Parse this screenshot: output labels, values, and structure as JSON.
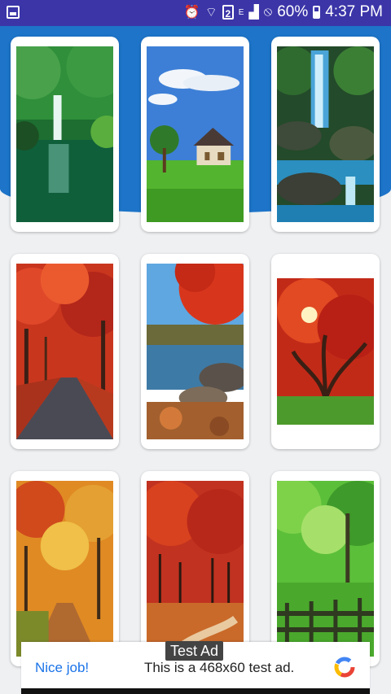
{
  "status_bar": {
    "battery": "60%",
    "time": "4:37 PM",
    "sim_badge": "2",
    "network_letter": "E"
  },
  "gallery": {
    "items": [
      {
        "name": "waterfall-forest"
      },
      {
        "name": "house-on-meadow"
      },
      {
        "name": "forest-waterfall-rocks"
      },
      {
        "name": "autumn-road"
      },
      {
        "name": "autumn-lake"
      },
      {
        "name": "red-maple-tree"
      },
      {
        "name": "autumn-path"
      },
      {
        "name": "autumn-trail"
      },
      {
        "name": "green-forest-fence"
      }
    ]
  },
  "ad": {
    "badge": "Test Ad",
    "title": "Nice job!",
    "description": "This is a 468x60 test ad."
  }
}
